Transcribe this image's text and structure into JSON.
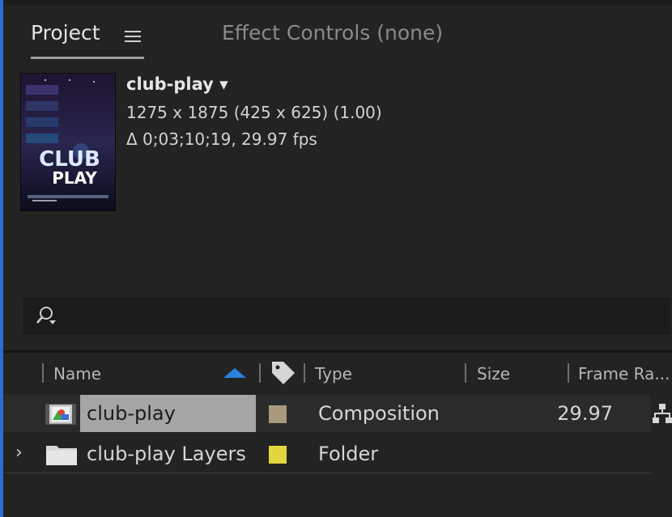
{
  "tabs": {
    "project_label": "Project",
    "effect_controls_label": "Effect Controls (none)"
  },
  "item_info": {
    "name": "club-play ▾",
    "dimensions": "1275 x 1875  (425 x 625) (1.00)",
    "duration": "Δ 0;03;10;19, 29.97 fps",
    "thumbnail_text_top": "CLUB",
    "thumbnail_text_bottom": "PLAY"
  },
  "search": {
    "icon": "search-icon",
    "value": ""
  },
  "columns": {
    "name": "Name",
    "type": "Type",
    "size": "Size",
    "frame_rate": "Frame Ra..."
  },
  "rows": [
    {
      "name": "club-play",
      "type": "Composition",
      "frame_rate": "29.97",
      "label_color": "#a99a7d",
      "icon": "composition-icon"
    },
    {
      "name": "club-play Layers",
      "type": "Folder",
      "frame_rate": "",
      "label_color": "#e3d53d",
      "icon": "folder-icon"
    }
  ],
  "colors": {
    "accent_blue": "#2a7fe0",
    "selection_gray": "#a5a5a5"
  }
}
